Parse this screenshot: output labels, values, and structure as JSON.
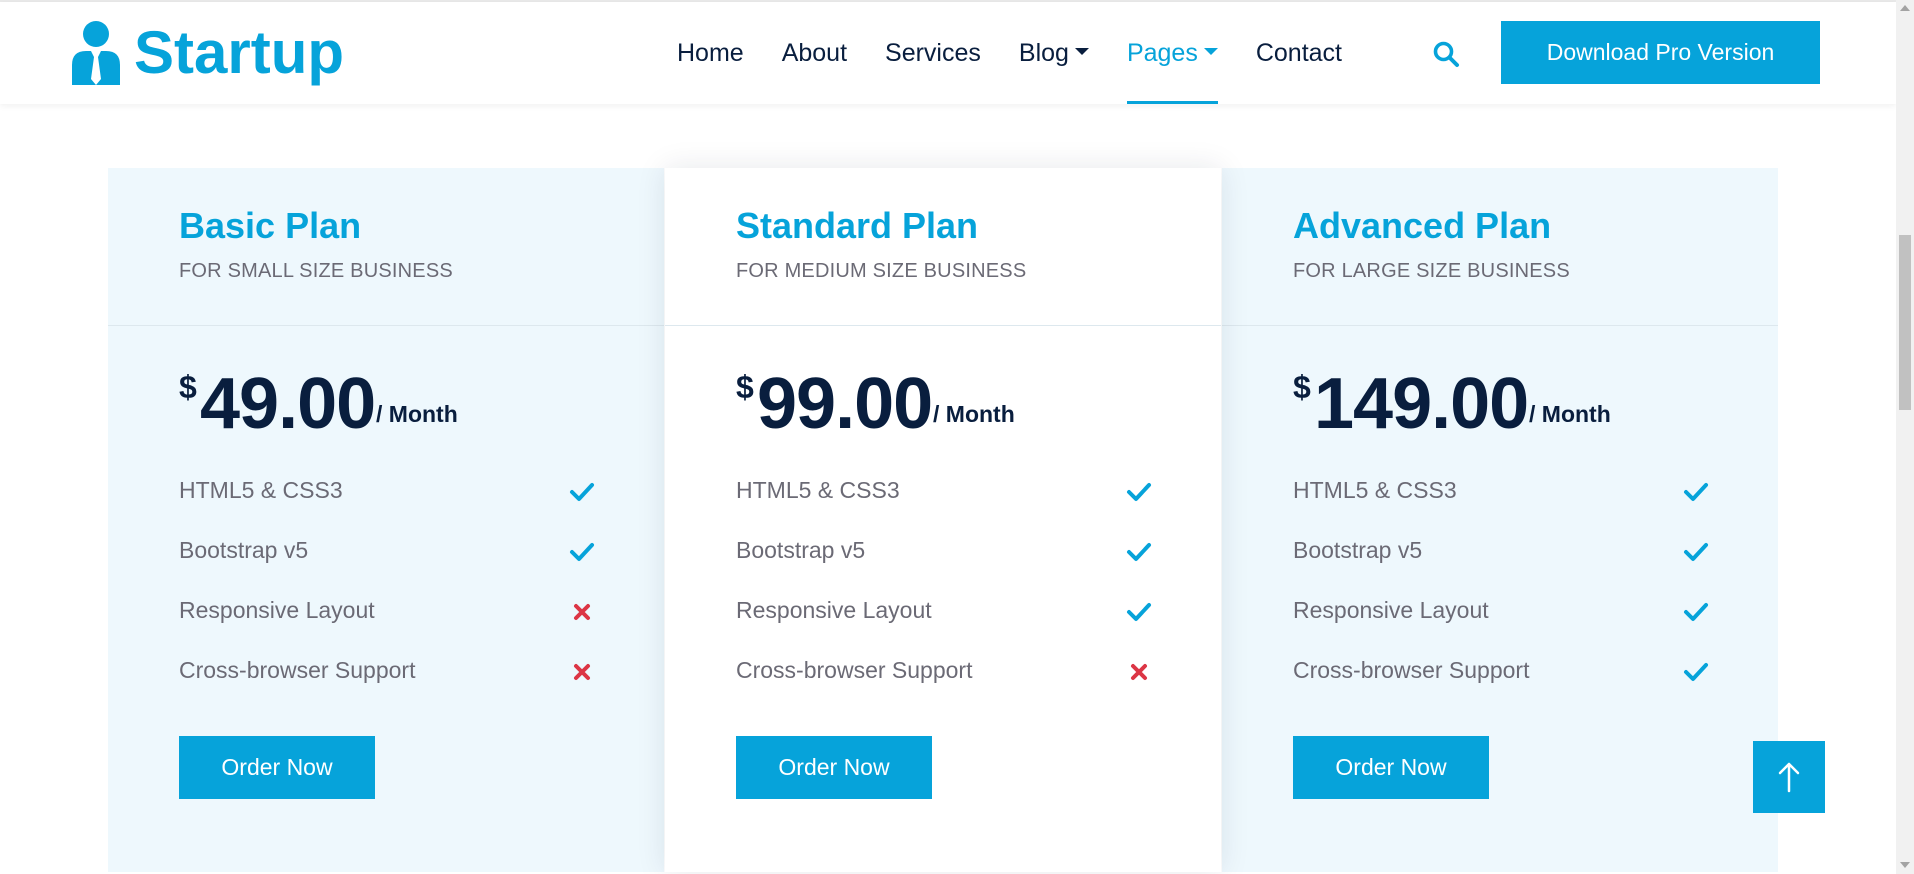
{
  "brand": {
    "name": "Startup",
    "color": "#06a3da",
    "icon": "user-tie-icon"
  },
  "nav": {
    "items": [
      {
        "label": "Home"
      },
      {
        "label": "About"
      },
      {
        "label": "Services"
      },
      {
        "label": "Blog"
      },
      {
        "label": "Pages"
      },
      {
        "label": "Contact"
      }
    ],
    "active_item": "Pages",
    "search_icon": "search-icon",
    "cta_label": "Download Pro Version"
  },
  "colors": {
    "accent": "#06a3da",
    "dark": "#091e3e",
    "check": "#06a3da",
    "cross": "#dc3545"
  },
  "plans": [
    {
      "name": "Basic Plan",
      "subtitle": "FOR SMALL SIZE BUSINESS",
      "currency": "$",
      "price": "49.00",
      "period": "/ Month",
      "features": [
        {
          "label": "HTML5 & CSS3",
          "included": true
        },
        {
          "label": "Bootstrap v5",
          "included": true
        },
        {
          "label": "Responsive Layout",
          "included": false
        },
        {
          "label": "Cross-browser Support",
          "included": false
        }
      ],
      "button_label": "Order Now"
    },
    {
      "name": "Standard Plan",
      "subtitle": "FOR MEDIUM SIZE BUSINESS",
      "currency": "$",
      "price": "99.00",
      "period": "/ Month",
      "features": [
        {
          "label": "HTML5 & CSS3",
          "included": true
        },
        {
          "label": "Bootstrap v5",
          "included": true
        },
        {
          "label": "Responsive Layout",
          "included": true
        },
        {
          "label": "Cross-browser Support",
          "included": false
        }
      ],
      "button_label": "Order Now"
    },
    {
      "name": "Advanced Plan",
      "subtitle": "FOR LARGE SIZE BUSINESS",
      "currency": "$",
      "price": "149.00",
      "period": "/ Month",
      "features": [
        {
          "label": "HTML5 & CSS3",
          "included": true
        },
        {
          "label": "Bootstrap v5",
          "included": true
        },
        {
          "label": "Responsive Layout",
          "included": true
        },
        {
          "label": "Cross-browser Support",
          "included": true
        }
      ],
      "button_label": "Order Now"
    }
  ],
  "back_to_top_icon": "arrow-up-icon"
}
